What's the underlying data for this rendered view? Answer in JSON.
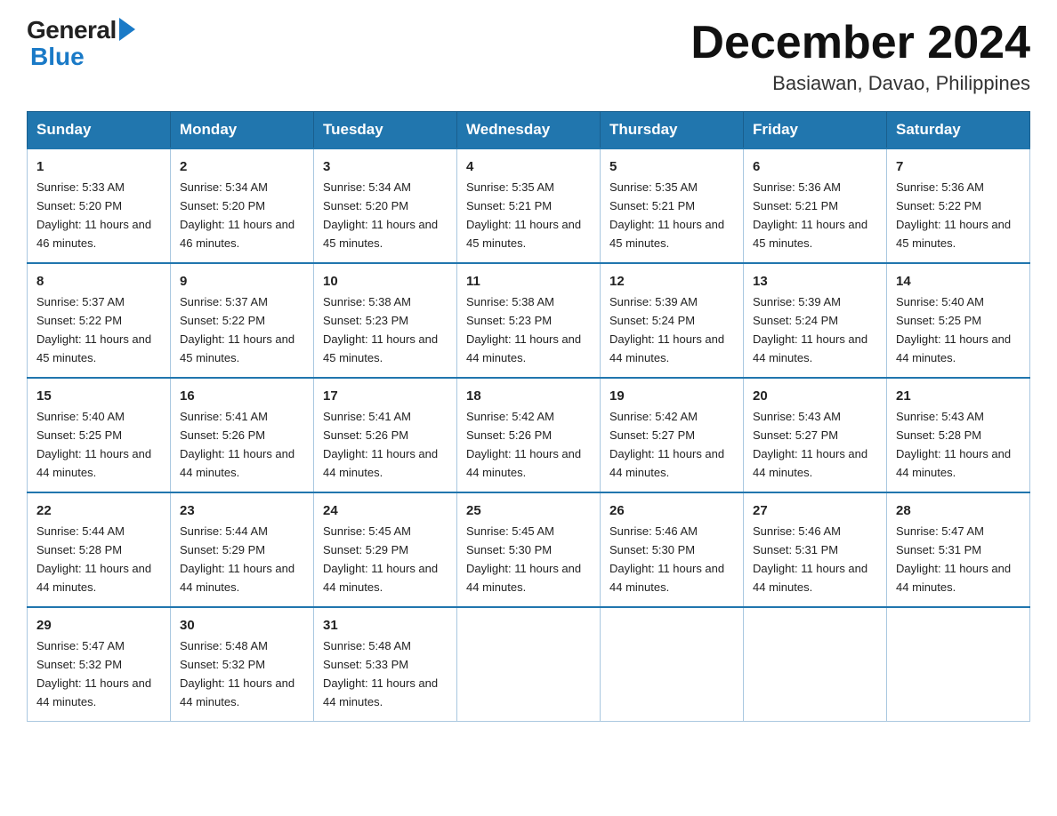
{
  "header": {
    "logo_general": "General",
    "logo_blue": "Blue",
    "month_title": "December 2024",
    "location": "Basiawan, Davao, Philippines"
  },
  "calendar": {
    "days_of_week": [
      "Sunday",
      "Monday",
      "Tuesday",
      "Wednesday",
      "Thursday",
      "Friday",
      "Saturday"
    ],
    "weeks": [
      {
        "days": [
          {
            "num": "1",
            "sunrise": "5:33 AM",
            "sunset": "5:20 PM",
            "daylight": "11 hours and 46 minutes."
          },
          {
            "num": "2",
            "sunrise": "5:34 AM",
            "sunset": "5:20 PM",
            "daylight": "11 hours and 46 minutes."
          },
          {
            "num": "3",
            "sunrise": "5:34 AM",
            "sunset": "5:20 PM",
            "daylight": "11 hours and 45 minutes."
          },
          {
            "num": "4",
            "sunrise": "5:35 AM",
            "sunset": "5:21 PM",
            "daylight": "11 hours and 45 minutes."
          },
          {
            "num": "5",
            "sunrise": "5:35 AM",
            "sunset": "5:21 PM",
            "daylight": "11 hours and 45 minutes."
          },
          {
            "num": "6",
            "sunrise": "5:36 AM",
            "sunset": "5:21 PM",
            "daylight": "11 hours and 45 minutes."
          },
          {
            "num": "7",
            "sunrise": "5:36 AM",
            "sunset": "5:22 PM",
            "daylight": "11 hours and 45 minutes."
          }
        ]
      },
      {
        "days": [
          {
            "num": "8",
            "sunrise": "5:37 AM",
            "sunset": "5:22 PM",
            "daylight": "11 hours and 45 minutes."
          },
          {
            "num": "9",
            "sunrise": "5:37 AM",
            "sunset": "5:22 PM",
            "daylight": "11 hours and 45 minutes."
          },
          {
            "num": "10",
            "sunrise": "5:38 AM",
            "sunset": "5:23 PM",
            "daylight": "11 hours and 45 minutes."
          },
          {
            "num": "11",
            "sunrise": "5:38 AM",
            "sunset": "5:23 PM",
            "daylight": "11 hours and 44 minutes."
          },
          {
            "num": "12",
            "sunrise": "5:39 AM",
            "sunset": "5:24 PM",
            "daylight": "11 hours and 44 minutes."
          },
          {
            "num": "13",
            "sunrise": "5:39 AM",
            "sunset": "5:24 PM",
            "daylight": "11 hours and 44 minutes."
          },
          {
            "num": "14",
            "sunrise": "5:40 AM",
            "sunset": "5:25 PM",
            "daylight": "11 hours and 44 minutes."
          }
        ]
      },
      {
        "days": [
          {
            "num": "15",
            "sunrise": "5:40 AM",
            "sunset": "5:25 PM",
            "daylight": "11 hours and 44 minutes."
          },
          {
            "num": "16",
            "sunrise": "5:41 AM",
            "sunset": "5:26 PM",
            "daylight": "11 hours and 44 minutes."
          },
          {
            "num": "17",
            "sunrise": "5:41 AM",
            "sunset": "5:26 PM",
            "daylight": "11 hours and 44 minutes."
          },
          {
            "num": "18",
            "sunrise": "5:42 AM",
            "sunset": "5:26 PM",
            "daylight": "11 hours and 44 minutes."
          },
          {
            "num": "19",
            "sunrise": "5:42 AM",
            "sunset": "5:27 PM",
            "daylight": "11 hours and 44 minutes."
          },
          {
            "num": "20",
            "sunrise": "5:43 AM",
            "sunset": "5:27 PM",
            "daylight": "11 hours and 44 minutes."
          },
          {
            "num": "21",
            "sunrise": "5:43 AM",
            "sunset": "5:28 PM",
            "daylight": "11 hours and 44 minutes."
          }
        ]
      },
      {
        "days": [
          {
            "num": "22",
            "sunrise": "5:44 AM",
            "sunset": "5:28 PM",
            "daylight": "11 hours and 44 minutes."
          },
          {
            "num": "23",
            "sunrise": "5:44 AM",
            "sunset": "5:29 PM",
            "daylight": "11 hours and 44 minutes."
          },
          {
            "num": "24",
            "sunrise": "5:45 AM",
            "sunset": "5:29 PM",
            "daylight": "11 hours and 44 minutes."
          },
          {
            "num": "25",
            "sunrise": "5:45 AM",
            "sunset": "5:30 PM",
            "daylight": "11 hours and 44 minutes."
          },
          {
            "num": "26",
            "sunrise": "5:46 AM",
            "sunset": "5:30 PM",
            "daylight": "11 hours and 44 minutes."
          },
          {
            "num": "27",
            "sunrise": "5:46 AM",
            "sunset": "5:31 PM",
            "daylight": "11 hours and 44 minutes."
          },
          {
            "num": "28",
            "sunrise": "5:47 AM",
            "sunset": "5:31 PM",
            "daylight": "11 hours and 44 minutes."
          }
        ]
      },
      {
        "days": [
          {
            "num": "29",
            "sunrise": "5:47 AM",
            "sunset": "5:32 PM",
            "daylight": "11 hours and 44 minutes."
          },
          {
            "num": "30",
            "sunrise": "5:48 AM",
            "sunset": "5:32 PM",
            "daylight": "11 hours and 44 minutes."
          },
          {
            "num": "31",
            "sunrise": "5:48 AM",
            "sunset": "5:33 PM",
            "daylight": "11 hours and 44 minutes."
          },
          null,
          null,
          null,
          null
        ]
      }
    ]
  }
}
